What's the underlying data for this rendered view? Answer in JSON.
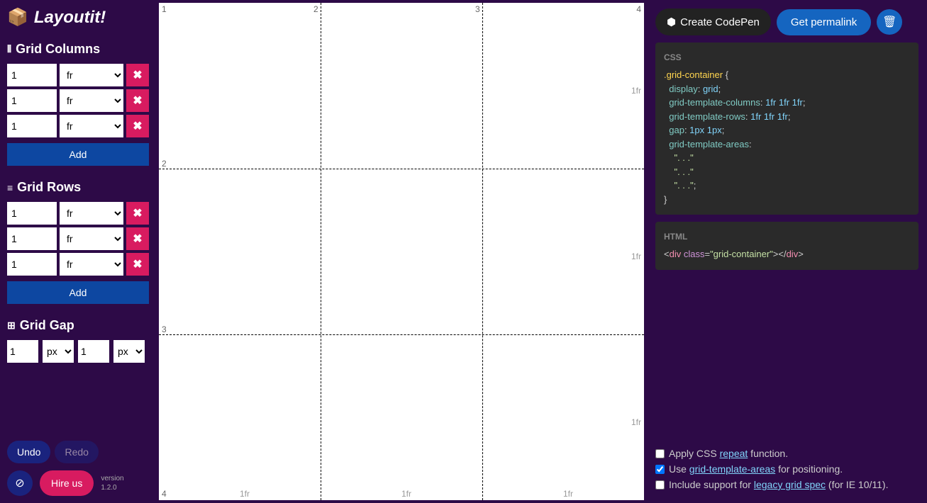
{
  "logo": {
    "text": "Layoutit!"
  },
  "sections": {
    "columns": {
      "title": "Grid Columns",
      "rows": [
        {
          "val": "1",
          "unit": "fr"
        },
        {
          "val": "1",
          "unit": "fr"
        },
        {
          "val": "1",
          "unit": "fr"
        }
      ],
      "add": "Add"
    },
    "rows": {
      "title": "Grid Rows",
      "rows": [
        {
          "val": "1",
          "unit": "fr"
        },
        {
          "val": "1",
          "unit": "fr"
        },
        {
          "val": "1",
          "unit": "fr"
        }
      ],
      "add": "Add"
    },
    "gap": {
      "title": "Grid Gap",
      "a_val": "1",
      "a_unit": "px",
      "b_val": "1",
      "b_unit": "px"
    }
  },
  "undo": "Undo",
  "redo": "Redo",
  "hire": "Hire us",
  "version": {
    "l1": "version",
    "l2": "1.2.0"
  },
  "canvas": {
    "nums": {
      "tl": "1",
      "t2": "2",
      "t3": "3",
      "t4": "4",
      "l2": "2",
      "l3": "3",
      "bl": "4"
    },
    "fr": "1fr"
  },
  "buttons": {
    "codepen": "Create CodePen",
    "permalink": "Get permalink"
  },
  "css": {
    "label": "CSS",
    "sel": ".grid-container",
    "p1": "display",
    "v1": "grid",
    "p2": "grid-template-columns",
    "v2": "1fr 1fr 1fr",
    "p3": "grid-template-rows",
    "v3": "1fr 1fr 1fr",
    "p4": "gap",
    "v4": "1px 1px",
    "p5": "grid-template-areas",
    "s1": "\". . .\"",
    "s2": "\". . .\"",
    "s3": "\". . .\""
  },
  "html": {
    "label": "HTML",
    "tag": "div",
    "attr": "class",
    "val": "\"grid-container\""
  },
  "checks": {
    "c1": {
      "pre": "Apply CSS ",
      "link": "repeat",
      "post": " function.",
      "checked": false
    },
    "c2": {
      "pre": "Use ",
      "link": "grid-template-areas",
      "post": " for positioning.",
      "checked": true
    },
    "c3": {
      "pre": "Include support for ",
      "link": "legacy grid spec",
      "post": " (for IE 10/11).",
      "checked": false
    }
  }
}
